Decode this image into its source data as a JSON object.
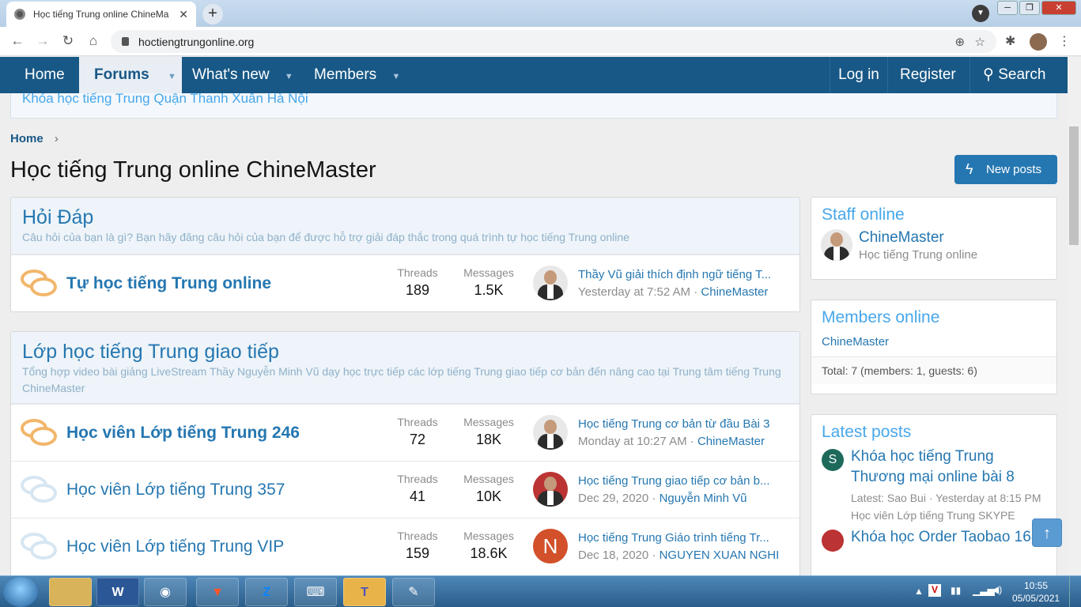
{
  "browser": {
    "tab_title": "Học tiếng Trung online ChineMa",
    "tab_close": "✕",
    "new_tab": "+",
    "url": "hoctiengtrungonline.org",
    "win_min": "─",
    "win_max": "❐",
    "win_close": "✕"
  },
  "nav": {
    "home": "Home",
    "forums": "Forums",
    "whats_new": "What's new",
    "members": "Members",
    "login": "Log in",
    "register": "Register",
    "search": "Search",
    "caret": "▼"
  },
  "notice": {
    "text": "Khóa học tiếng Trung Quận Thanh Xuân Hà Nội"
  },
  "breadcrumb": {
    "home": "Home",
    "sep": "›"
  },
  "page": {
    "title": "Học tiếng Trung online ChineMaster",
    "new_posts": "New posts"
  },
  "categories": [
    {
      "title": "Hỏi Đáp",
      "desc": "Câu hỏi của bạn là gì? Bạn hãy đăng câu hỏi của bạn để được hỗ trợ giải đáp thắc trong quá trình tự học tiếng Trung online",
      "nodes": [
        {
          "title": "Tự học tiếng Trung online",
          "threads_label": "Threads",
          "threads": "189",
          "messages_label": "Messages",
          "messages": "1.5K",
          "last_title": "Thầy Vũ giải thích định ngữ tiếng T...",
          "last_time": "Yesterday at 7:52 AM",
          "last_user": "ChineMaster"
        }
      ]
    },
    {
      "title": "Lớp học tiếng Trung giao tiếp",
      "desc": "Tổng hợp video bài giảng LiveStream Thầy Nguyễn Minh Vũ dạy học trực tiếp các lớp tiếng Trung giao tiếp cơ bản đến nâng cao tại Trung tâm tiếng Trung ChineMaster",
      "nodes": [
        {
          "title": "Học viên Lớp tiếng Trung 246",
          "threads_label": "Threads",
          "threads": "72",
          "messages_label": "Messages",
          "messages": "18K",
          "last_title": "Học tiếng Trung cơ bản từ đầu Bài 3",
          "last_time": "Monday at 10:27 AM",
          "last_user": "ChineMaster"
        },
        {
          "title": "Học viên Lớp tiếng Trung 357",
          "threads_label": "Threads",
          "threads": "41",
          "messages_label": "Messages",
          "messages": "10K",
          "last_title": "Học tiếng Trung giao tiếp cơ bản b...",
          "last_time": "Dec 29, 2020",
          "last_user": "Nguyễn Minh Vũ"
        },
        {
          "title": "Học viên Lớp tiếng Trung VIP",
          "threads_label": "Threads",
          "threads": "159",
          "messages_label": "Messages",
          "messages": "18.6K",
          "last_title": "Học tiếng Trung Giáo trình tiếng Tr...",
          "last_time": "Dec 18, 2020",
          "last_user": "NGUYEN XUAN NGHI",
          "avatar_letter": "N"
        }
      ]
    }
  ],
  "sidebar": {
    "staff_title": "Staff online",
    "staff_name": "ChineMaster",
    "staff_sub": "Học tiếng Trung online",
    "members_title": "Members online",
    "member_name": "ChineMaster",
    "members_total": "Total: 7 (members: 1, guests: 6)",
    "latest_title": "Latest posts",
    "latest": [
      {
        "avatar": "S",
        "title": "Khóa học tiếng Trung Thương mại online bài 8",
        "meta": "Latest: Sao Bui · Yesterday at 8:15 PM",
        "forum": "Học viên Lớp tiếng Trung SKYPE"
      },
      {
        "title": "Khóa học Order Taobao 1688"
      }
    ]
  },
  "to_top": "↑",
  "taskbar": {
    "time": "10:55",
    "date": "05/05/2021"
  }
}
